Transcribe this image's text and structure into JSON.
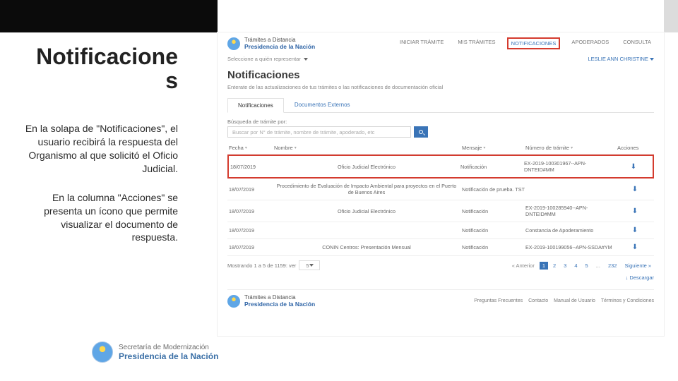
{
  "left": {
    "title1": "Notificacione",
    "title2": "s",
    "para1": "En la solapa de \"Notificaciones\", el usuario recibirá la respuesta del Organismo al que solicitó el Oficio Judicial.",
    "para2": "En la columna \"Acciones\" se presenta un ícono que permite visualizar el documento de respuesta."
  },
  "brand": {
    "line1": "Trámites a Distancia",
    "line2": "Presidencia de la Nación"
  },
  "nav": {
    "items": [
      "INICIAR TRÁMITE",
      "MIS TRÁMITES",
      "NOTIFICACIONES",
      "APODERADOS",
      "CONSULTA"
    ]
  },
  "rep_label": "Seleccione a quién representar",
  "user": "LESLIE ANN CHRISTINE",
  "page_title": "Notificaciones",
  "page_sub": "Enterate de las actualizaciones de tus trámites o las notificaciones de documentación oficial",
  "tabs": {
    "a": "Notificaciones",
    "b": "Documentos Externos"
  },
  "search": {
    "label": "Búsqueda de trámite por:",
    "placeholder": "Buscar por N° de trámite, nombre de trámite, apoderado, etc"
  },
  "thead": {
    "c0": "Fecha",
    "c1": "Nombre",
    "c2": "Mensaje",
    "c3": "Número de trámite",
    "c4": "Acciones"
  },
  "rows": [
    {
      "c0": "18/07/2019",
      "c1": "Oficio Judicial Electrónico",
      "c2": "Notificación",
      "c3": "EX-2019-100301967--APN-DNTEID#MM"
    },
    {
      "c0": "18/07/2019",
      "c1": "Procedimiento de Evaluación de Impacto Ambiental para proyectos en el Puerto de Buenos Aires",
      "c2": "Notificación de prueba. TST",
      "c3": ""
    },
    {
      "c0": "18/07/2019",
      "c1": "Oficio Judicial Electrónico",
      "c2": "Notificación",
      "c3": "EX-2019-100285940--APN-DNTEID#MM"
    },
    {
      "c0": "18/07/2019",
      "c1": "",
      "c2": "Notificación",
      "c3": "Constancia de Apoderamiento"
    },
    {
      "c0": "18/07/2019",
      "c1": "CONIN Centros: Presentación Mensual",
      "c2": "Notificación",
      "c3": "EX-2019-100199056--APN-SSDA#YM"
    }
  ],
  "pager": {
    "showing": "Mostrando 1 a 5 de 1159: ver",
    "per": "5",
    "prev": "« Anterior",
    "pages": [
      "1",
      "2",
      "3",
      "4",
      "5",
      "...",
      "232"
    ],
    "next": "Siguiente »"
  },
  "dl_all": "↓ Descargar",
  "footer": {
    "links": [
      "Preguntas Frecuentes",
      "Contacto",
      "Manual de Usuario",
      "Términos y Condiciones"
    ]
  },
  "secretaria": {
    "l1": "Secretaría de Modernización",
    "l2": "Presidencia de la Nación"
  }
}
